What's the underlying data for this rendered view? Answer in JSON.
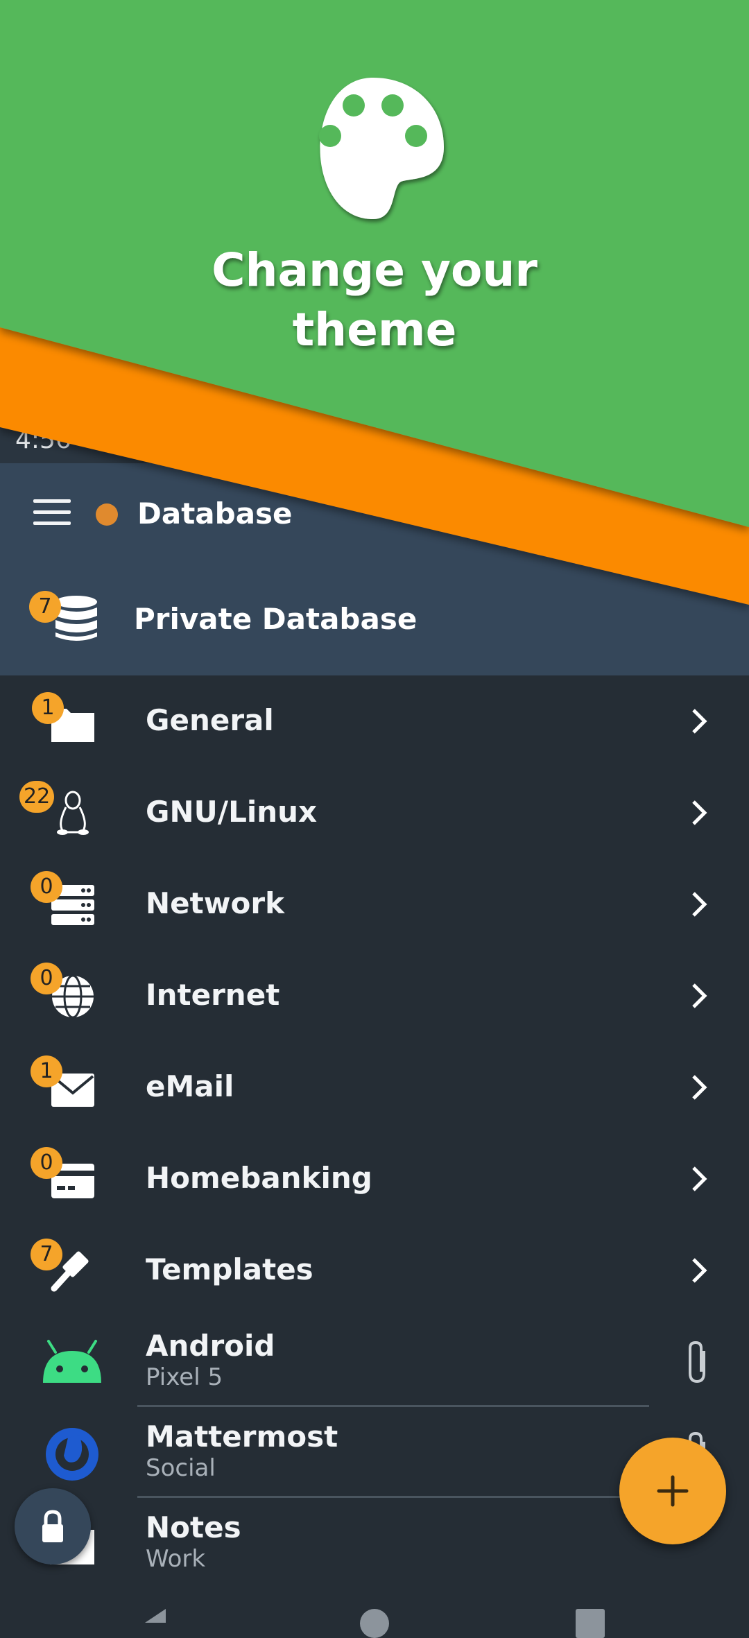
{
  "statusbar": {
    "time": "4:56"
  },
  "promo": {
    "title_line1": "Change your",
    "title_line2": "theme",
    "icon": "palette-icon"
  },
  "toolbar": {
    "title": "Database",
    "menu_icon": "hamburger-icon"
  },
  "database": {
    "name": "Private Database",
    "count": "7",
    "icon": "database-icon"
  },
  "groups": [
    {
      "label": "General",
      "count": "1",
      "icon": "folder-icon"
    },
    {
      "label": "GNU/Linux",
      "count": "22",
      "icon": "linux-icon"
    },
    {
      "label": "Network",
      "count": "0",
      "icon": "server-icon"
    },
    {
      "label": "Internet",
      "count": "0",
      "icon": "globe-icon"
    },
    {
      "label": "eMail",
      "count": "1",
      "icon": "envelope-icon"
    },
    {
      "label": "Homebanking",
      "count": "0",
      "icon": "credit-card-icon"
    },
    {
      "label": "Templates",
      "count": "7",
      "icon": "gavel-icon"
    }
  ],
  "entries": [
    {
      "title": "Android",
      "subtitle": "Pixel 5",
      "icon": "android-icon"
    },
    {
      "title": "Mattermost",
      "subtitle": "Social",
      "icon": "mattermost-icon"
    },
    {
      "title": "Notes",
      "subtitle": "Work",
      "icon": "note-icon"
    }
  ],
  "colors": {
    "green": "#55b85a",
    "orange": "#fb8a00",
    "accent": "#f5a42a",
    "header": "#35475a",
    "background": "#252d35"
  }
}
